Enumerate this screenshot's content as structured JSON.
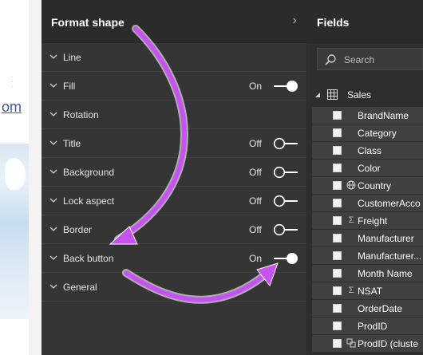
{
  "format_panel": {
    "title": "Format shape",
    "rows": [
      {
        "label": "Line",
        "state": "",
        "toggle": null
      },
      {
        "label": "Fill",
        "state": "On",
        "toggle": "on"
      },
      {
        "label": "Rotation",
        "state": "",
        "toggle": null
      },
      {
        "label": "Title",
        "state": "Off",
        "toggle": "off"
      },
      {
        "label": "Background",
        "state": "Off",
        "toggle": "off"
      },
      {
        "label": "Lock aspect",
        "state": "Off",
        "toggle": "off"
      },
      {
        "label": "Border",
        "state": "Off",
        "toggle": "off"
      },
      {
        "label": "Back button",
        "state": "On",
        "toggle": "on"
      },
      {
        "label": "General",
        "state": "",
        "toggle": null
      }
    ]
  },
  "fields_panel": {
    "title": "Fields",
    "search_placeholder": "Search",
    "table_name": "Sales",
    "fields": [
      {
        "name": "BrandName",
        "icon": ""
      },
      {
        "name": "Category",
        "icon": ""
      },
      {
        "name": "Class",
        "icon": ""
      },
      {
        "name": "Color",
        "icon": ""
      },
      {
        "name": "Country",
        "icon": "globe-icon"
      },
      {
        "name": "CustomerAcco",
        "icon": ""
      },
      {
        "name": "Freight",
        "icon": "sigma-icon"
      },
      {
        "name": "Manufacturer",
        "icon": ""
      },
      {
        "name": "Manufacturer...",
        "icon": ""
      },
      {
        "name": "Month Name",
        "icon": ""
      },
      {
        "name": "NSAT",
        "icon": "sigma-icon"
      },
      {
        "name": "OrderDate",
        "icon": ""
      },
      {
        "name": "ProdID",
        "icon": ""
      },
      {
        "name": "ProdID (cluste",
        "icon": "cluster-icon"
      }
    ]
  },
  "canvas": {
    "link_fragment": "om"
  },
  "colors": {
    "arrow": "#c653f0",
    "panel_bg": "#353535",
    "header_bg": "#2b2b2b",
    "field_row_bg": "#404040"
  }
}
